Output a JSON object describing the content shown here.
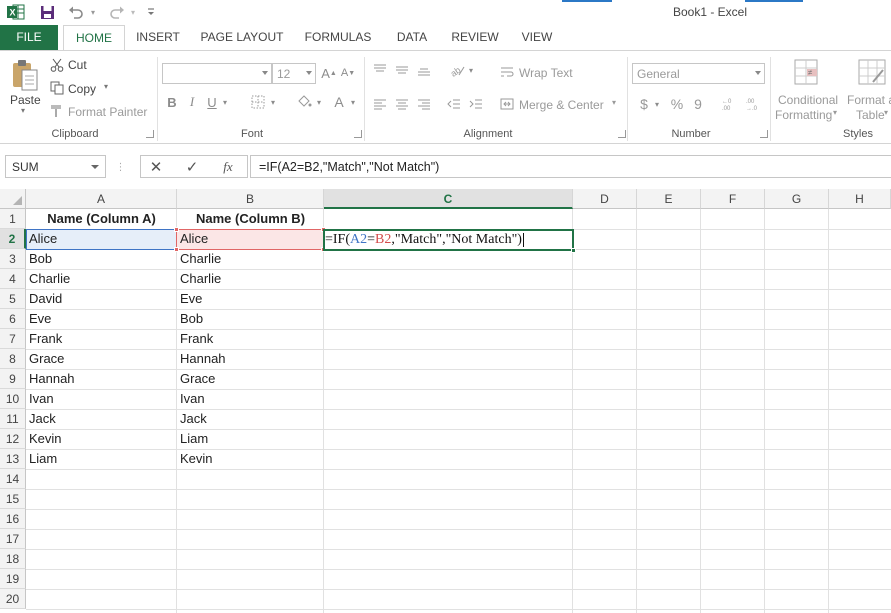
{
  "title_bar": {
    "title": "Book1 - Excel",
    "excel_icon": "excel-logo-icon",
    "save_icon": "save-icon",
    "undo_icon": "undo-icon",
    "redo_icon": "redo-icon",
    "customize_icon": "customize-quick-access-icon"
  },
  "tabs": [
    "FILE",
    "HOME",
    "INSERT",
    "PAGE LAYOUT",
    "FORMULAS",
    "DATA",
    "REVIEW",
    "VIEW"
  ],
  "ribbon": {
    "clipboard": {
      "paste": "Paste",
      "cut": "Cut",
      "copy": "Copy",
      "format_painter": "Format Painter",
      "label": "Clipboard"
    },
    "font": {
      "font_name": "",
      "font_size": "12",
      "bold": "B",
      "italic": "I",
      "underline": "U",
      "label": "Font",
      "font_color": "A"
    },
    "alignment": {
      "wrap_text": "Wrap Text",
      "merge_center": "Merge & Center",
      "label": "Alignment"
    },
    "number": {
      "format": "General",
      "currency": "$",
      "percent": "%",
      "comma": "9",
      "label": "Number"
    },
    "styles": {
      "conditional_formatting_line1": "Conditional",
      "conditional_formatting_line2": "Formatting",
      "format_table_line1": "Format a",
      "format_table_line2": "Table",
      "label": "Styles"
    }
  },
  "formula_bar": {
    "name_box": "SUM",
    "cancel": "✕",
    "enter": "✓",
    "fx": "fx",
    "formula": "=IF(A2=B2,\"Match\",\"Not Match\")"
  },
  "sheet": {
    "columns": [
      "A",
      "B",
      "C",
      "D",
      "E",
      "F",
      "G",
      "H"
    ],
    "rows": [
      "1",
      "2",
      "3",
      "4",
      "5",
      "6",
      "7",
      "8",
      "9",
      "10",
      "11",
      "12",
      "13",
      "14",
      "15",
      "16",
      "17",
      "18",
      "19",
      "20"
    ],
    "header_row": [
      "Name (Column A)",
      "Name (Column B)"
    ],
    "data": [
      [
        "Alice",
        "Alice"
      ],
      [
        "Bob",
        "Charlie"
      ],
      [
        "Charlie",
        "Charlie"
      ],
      [
        "David",
        "Eve"
      ],
      [
        "Eve",
        "Bob"
      ],
      [
        "Frank",
        "Frank"
      ],
      [
        "Grace",
        "Hannah"
      ],
      [
        "Hannah",
        "Grace"
      ],
      [
        "Ivan",
        "Ivan"
      ],
      [
        "Jack",
        "Jack"
      ],
      [
        "Kevin",
        "Liam"
      ],
      [
        "Liam",
        "Kevin"
      ]
    ],
    "editing_cell": {
      "prefix": "=IF(",
      "ref_a": "A2",
      "eq": "=",
      "ref_b": "B2",
      "suffix": ",\"Match\",\"Not Match\")"
    },
    "colors": {
      "accent": "#217346",
      "ref_a": "#3f74c5",
      "ref_b": "#d34c4c"
    }
  }
}
